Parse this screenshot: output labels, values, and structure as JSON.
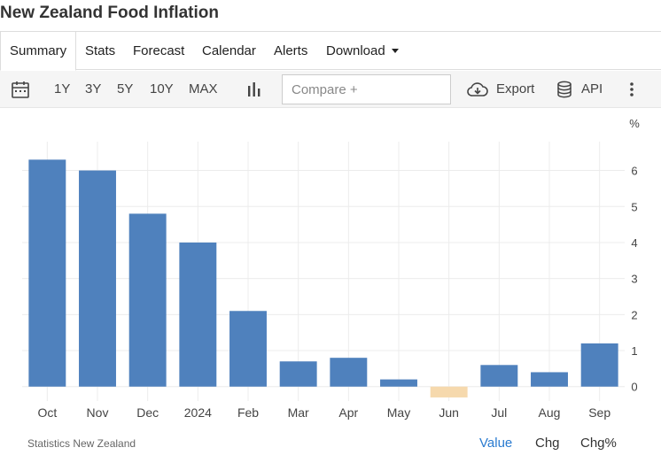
{
  "title": "New Zealand Food Inflation",
  "tabs": [
    "Summary",
    "Stats",
    "Forecast",
    "Calendar",
    "Alerts",
    "Download"
  ],
  "toolbar": {
    "ranges": [
      "1Y",
      "3Y",
      "5Y",
      "10Y",
      "MAX"
    ],
    "compare_placeholder": "Compare +",
    "export_label": "Export",
    "api_label": "API"
  },
  "footer": {
    "source": "Statistics New Zealand",
    "buttons": [
      "Value",
      "Chg",
      "Chg%"
    ]
  },
  "colors": {
    "positive": "#4f81bd",
    "negative": "#f6d9ad",
    "active_link": "#2a7bd0"
  },
  "chart_data": {
    "type": "bar",
    "unit_label": "%",
    "categories": [
      "Oct",
      "Nov",
      "Dec",
      "2024",
      "Feb",
      "Mar",
      "Apr",
      "May",
      "Jun",
      "Jul",
      "Aug",
      "Sep"
    ],
    "values": [
      6.3,
      6.0,
      4.8,
      4.0,
      2.1,
      0.7,
      0.8,
      0.2,
      -0.3,
      0.6,
      0.4,
      1.2
    ],
    "yticks": [
      0,
      1,
      2,
      3,
      4,
      5,
      6
    ],
    "ylim": [
      -0.4,
      6.8
    ],
    "grid": true,
    "y_axis_position": "right"
  }
}
